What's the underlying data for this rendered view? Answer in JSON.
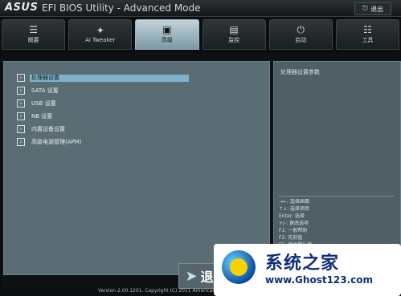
{
  "header": {
    "brand": "ASUS",
    "title": "EFI BIOS Utility - Advanced Mode",
    "exit_label": "退出"
  },
  "tabs": [
    {
      "label": "概要",
      "icon": "list-icon"
    },
    {
      "label": "Ai Tweaker",
      "icon": "tweaker-icon"
    },
    {
      "label": "高级",
      "icon": "advanced-icon",
      "active": true
    },
    {
      "label": "监控",
      "icon": "monitor-icon"
    },
    {
      "label": "启动",
      "icon": "power-icon"
    },
    {
      "label": "工具",
      "icon": "tools-icon"
    }
  ],
  "menu": [
    {
      "label": "处理器设置",
      "selected": true
    },
    {
      "label": "SATA 设置"
    },
    {
      "label": "USB 设置"
    },
    {
      "label": "NB 设置"
    },
    {
      "label": "内置设备设置"
    },
    {
      "label": "高级电源管理(APM)"
    }
  ],
  "help": {
    "text": "处理器设置参数",
    "keys": [
      "→←: 选择画面",
      "↑↓: 选择项目",
      "Enter: 选择",
      "+/-: 更改选项",
      "F1: 一般帮助",
      "F2: 先前值",
      "F5: 载体默认值"
    ]
  },
  "footer": {
    "version": "Version 2.00.1201. Copyright (C) 2011 American Megatrends, Inc."
  },
  "next_button": {
    "text": "退"
  },
  "watermark": {
    "title": "系统之家",
    "url": "www.Ghost123.com"
  }
}
